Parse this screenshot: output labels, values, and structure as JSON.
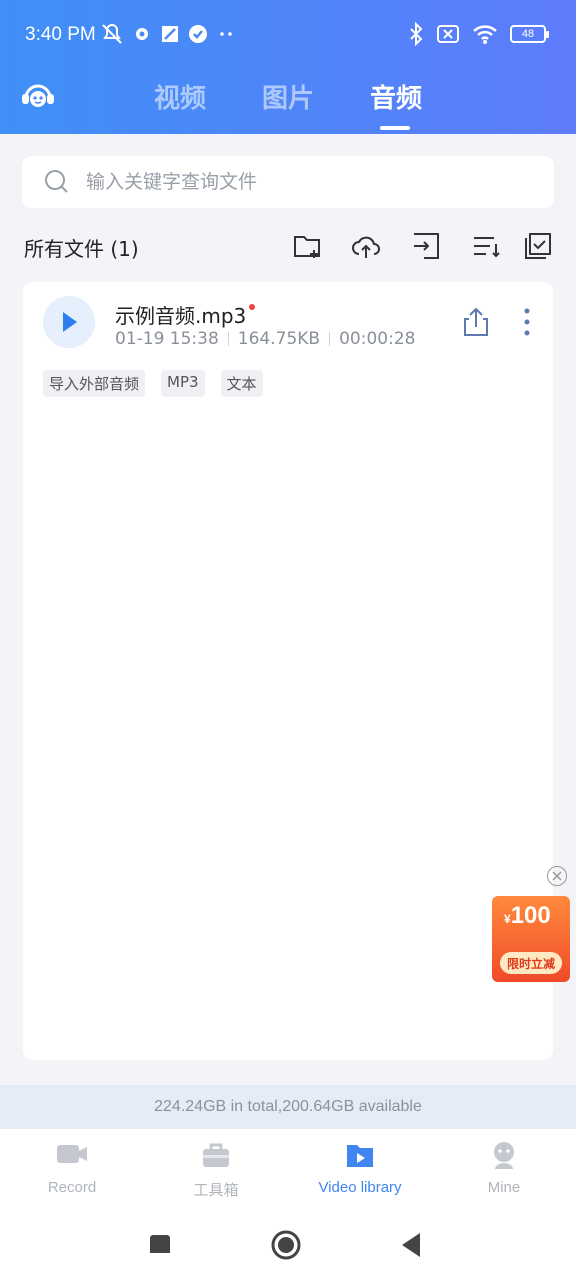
{
  "status": {
    "time": "3:40 PM",
    "battery": "48"
  },
  "tabs": [
    {
      "label": "视频"
    },
    {
      "label": "图片"
    },
    {
      "label": "音频"
    }
  ],
  "search": {
    "placeholder": "输入关键字查询文件"
  },
  "toolbar": {
    "title": "所有文件 (1)",
    "icons": [
      "new-folder-icon",
      "cloud-upload-icon",
      "import-icon",
      "sort-icon",
      "multi-select-icon"
    ]
  },
  "files": [
    {
      "name": "示例音频.mp3",
      "date": "01-19 15:38",
      "size": "164.75KB",
      "duration": "00:00:28",
      "tags": [
        "导入外部音频",
        "MP3",
        "文本"
      ]
    }
  ],
  "promo": {
    "currency": "¥",
    "amount": "100",
    "label": "限时立减"
  },
  "storage": {
    "text": "224.24GB in total,200.64GB available"
  },
  "bottom_nav": [
    {
      "label": "Record",
      "icon": "camera-icon"
    },
    {
      "label": "工具箱",
      "icon": "toolbox-icon"
    },
    {
      "label": "Video library",
      "icon": "video-folder-icon"
    },
    {
      "label": "Mine",
      "icon": "user-icon"
    }
  ],
  "colors": {
    "accent": "#3f86f2",
    "header_start": "#3f8ff6",
    "header_end": "#5e7cfb",
    "promo": "#f04a2a"
  }
}
